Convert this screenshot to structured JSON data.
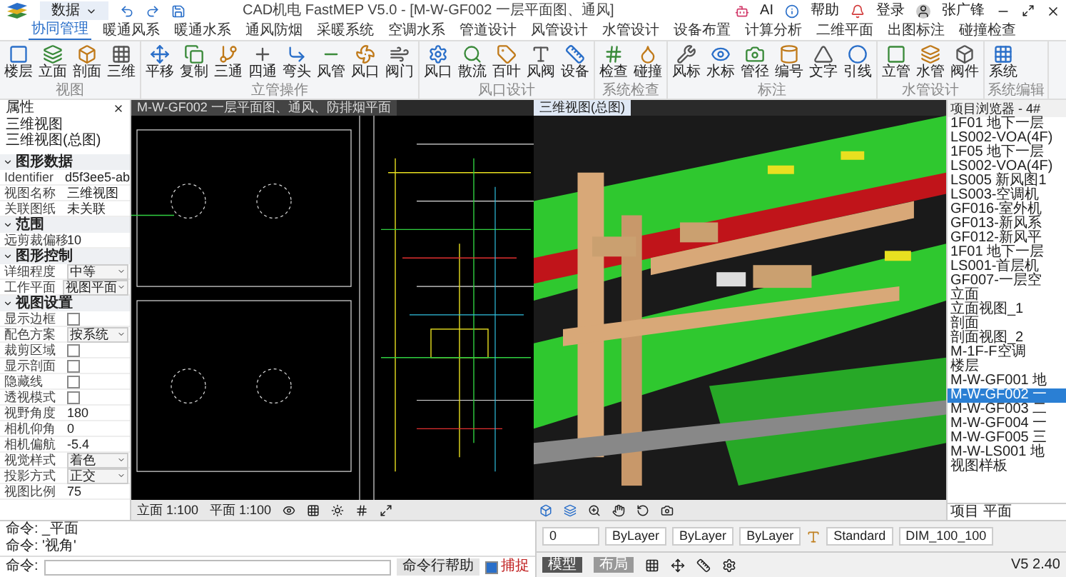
{
  "title_bar": {
    "app_menu": "数据",
    "title": "CAD机电 FastMEP V5.0 - [M-W-GF002 一层平面图、通风]",
    "ai": "AI",
    "help": "帮助",
    "login": "登录",
    "user": "张广锋"
  },
  "ribbon_tabs": [
    {
      "label": "协同管理",
      "selected": true
    },
    {
      "label": "暖通风系",
      "selected": false
    },
    {
      "label": "暖通水系",
      "selected": false
    },
    {
      "label": "通风防烟",
      "selected": false
    },
    {
      "label": "采暖系统",
      "selected": false
    },
    {
      "label": "空调水系",
      "selected": false
    },
    {
      "label": "管道设计",
      "selected": false
    },
    {
      "label": "风管设计",
      "selected": false
    },
    {
      "label": "水管设计",
      "selected": false
    },
    {
      "label": "设备布置",
      "selected": false
    },
    {
      "label": "计算分析",
      "selected": false
    },
    {
      "label": "二维平面",
      "selected": false
    },
    {
      "label": "出图标注",
      "selected": false
    },
    {
      "label": "碰撞检查",
      "selected": false
    }
  ],
  "ribbon_groups": [
    {
      "label": "视图",
      "buttons": [
        "楼层",
        "立面",
        "剖面",
        "三维"
      ]
    },
    {
      "label": "立管操作",
      "buttons": [
        "平移",
        "复制",
        "三通",
        "四通",
        "弯头",
        "风管",
        "风口",
        "阀门"
      ]
    },
    {
      "label": "风口设计",
      "buttons": [
        "风口",
        "散流",
        "百叶",
        "风阀",
        "设备"
      ]
    },
    {
      "label": "系统检查",
      "buttons": [
        "检查",
        "碰撞"
      ]
    },
    {
      "label": "标注",
      "buttons": [
        "风标",
        "水标",
        "管径",
        "编号",
        "文字",
        "引线"
      ]
    },
    {
      "label": "水管设计",
      "buttons": [
        "立管",
        "水管",
        "阀件"
      ]
    },
    {
      "label": "系统编辑",
      "buttons": [
        "系统"
      ]
    }
  ],
  "properties_panel": {
    "title": "属性",
    "view_type": "三维视图",
    "view_name": "三维视图(总图)",
    "sections": [
      {
        "label": "图形数据",
        "expanded": true,
        "rows": [
          {
            "kind": "text",
            "label": "Identifier",
            "value": "d5f3ee5-ab"
          },
          {
            "kind": "text",
            "label": "视图名称",
            "value": "三维视图"
          },
          {
            "kind": "text",
            "label": "关联图纸",
            "value": "未关联"
          }
        ]
      },
      {
        "label": "范围",
        "expanded": true,
        "rows": [
          {
            "kind": "text",
            "label": "远剪裁偏移",
            "value": "10"
          }
        ]
      },
      {
        "label": "图形控制",
        "expanded": true,
        "rows": [
          {
            "kind": "dropdown",
            "label": "详细程度",
            "value": "中等"
          },
          {
            "kind": "dropdown",
            "label": "工作平面",
            "value": "视图平面"
          }
        ]
      },
      {
        "label": "视图设置",
        "expanded": true,
        "rows": [
          {
            "kind": "checkbox",
            "label": "显示边框",
            "checked": false
          },
          {
            "kind": "dropdown",
            "label": "配色方案",
            "value": "按系统"
          },
          {
            "kind": "checkbox",
            "label": "裁剪区域",
            "checked": false
          },
          {
            "kind": "checkbox",
            "label": "显示剖面",
            "checked": false
          },
          {
            "kind": "checkbox",
            "label": "隐藏线",
            "checked": false
          },
          {
            "kind": "checkbox",
            "label": "透视模式",
            "checked": false
          },
          {
            "kind": "text",
            "label": "视野角度",
            "value": "180"
          },
          {
            "kind": "text",
            "label": "相机仰角",
            "value": "0"
          },
          {
            "kind": "text",
            "label": "相机偏航",
            "value": "-5.4"
          },
          {
            "kind": "dropdown",
            "label": "视觉样式",
            "value": "着色"
          },
          {
            "kind": "dropdown",
            "label": "投影方式",
            "value": "正交"
          },
          {
            "kind": "text",
            "label": "视图比例",
            "value": "75"
          }
        ]
      }
    ]
  },
  "plan_view": {
    "tab": "M-W-GF002 一层平面图、通风、防排烟平面",
    "elevation_scale": "立面 1:100",
    "plan_scale": "平面 1:100"
  },
  "model_view": {
    "tab": "三维视图(总图)"
  },
  "project_browser": {
    "title": "项目浏览器 - 4#",
    "items": [
      {
        "label": "1F01 地下一层",
        "selected": false
      },
      {
        "label": "LS002-VOA(4F)",
        "selected": false
      },
      {
        "label": "1F05 地下一层",
        "selected": false
      },
      {
        "label": "LS002-VOA(4F)",
        "selected": false
      },
      {
        "label": "LS005 新风图1",
        "selected": false
      },
      {
        "label": "LS003-空调机",
        "selected": false
      },
      {
        "label": "GF016-室外机",
        "selected": false
      },
      {
        "label": "GF013-新风系",
        "selected": false
      },
      {
        "label": "GF012-新风平",
        "selected": false
      },
      {
        "label": "1F01 地下一层",
        "selected": false
      },
      {
        "label": "LS001-首层机",
        "selected": false
      },
      {
        "label": "GF007-一层空",
        "selected": false
      },
      {
        "label": "立面",
        "selected": false
      },
      {
        "label": "立面视图_1",
        "selected": false
      },
      {
        "label": "剖面",
        "selected": false
      },
      {
        "label": "剖面视图_2",
        "selected": false
      },
      {
        "label": "M-1F-F空调",
        "selected": false
      },
      {
        "label": "楼层",
        "selected": false
      },
      {
        "label": "M-W-GF001 地",
        "selected": false
      },
      {
        "label": "M-W-GF002 一",
        "selected": true
      },
      {
        "label": "M-W-GF003 二",
        "selected": false
      },
      {
        "label": "M-W-GF004 一",
        "selected": false
      },
      {
        "label": "M-W-GF005 三",
        "selected": false
      },
      {
        "label": "M-W-LS001 地",
        "selected": false
      },
      {
        "label": "视图样板",
        "selected": false
      }
    ],
    "footer": "项目 平面"
  },
  "command_area": {
    "history": [
      "命令: _平面",
      "命令: '视角'"
    ],
    "prompt": "命令:",
    "help_button": "命令行帮助",
    "snap": {
      "label": "捕捉",
      "checked": true
    }
  },
  "layer_bar": {
    "layer": "0",
    "color_layer": "ByLayer",
    "linetype": "ByLayer",
    "lineweight": "ByLayer",
    "text_style": "Standard",
    "dim_style": "DIM_100_100"
  },
  "status_bar": {
    "model": "模型",
    "layout": "布局",
    "version": "V5 2.40"
  }
}
